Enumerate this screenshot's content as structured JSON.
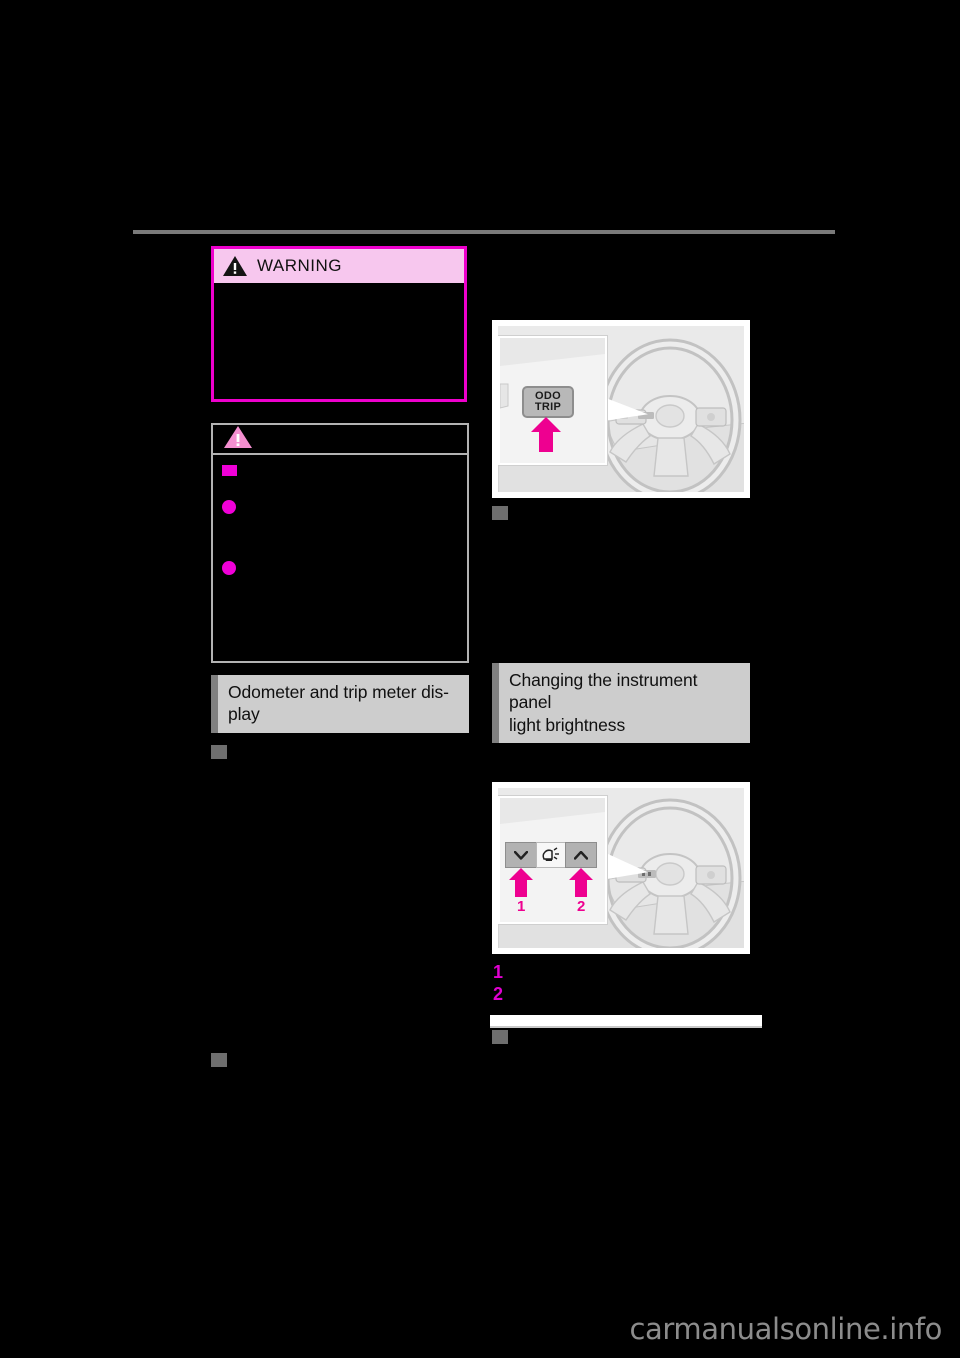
{
  "document": {
    "watermark": "carmanualsonline.info"
  },
  "left_column": {
    "warning_box": {
      "icon": "warning-triangle-icon",
      "title": "WARNING",
      "body_text": ""
    },
    "notice_box": {
      "icon": "notice-triangle-icon",
      "bullets": [
        {
          "marker": "square",
          "text": ""
        },
        {
          "marker": "circle",
          "text": ""
        },
        {
          "marker": "circle",
          "text": ""
        }
      ]
    },
    "section_heading": "Odometer and trip meter dis-\nplay",
    "subsections": [
      {
        "marker": "gray-square",
        "text": ""
      },
      {
        "marker": "gray-square",
        "text": ""
      }
    ]
  },
  "right_column": {
    "illustration_odo": {
      "name": "steering-wheel-odo-trip-illustration",
      "button_label_line1": "ODO",
      "button_label_line2": "TRIP",
      "arrow": "magenta-up-arrow"
    },
    "subsection_after_illustration": {
      "marker": "gray-square",
      "text": ""
    },
    "section_heading": "Changing the instrument panel\nlight brightness",
    "illustration_brightness": {
      "name": "instrument-panel-brightness-illustration",
      "buttons": [
        {
          "number": "1",
          "icon": "chevron-down-icon"
        },
        {
          "icon": "brightness-lamp-icon"
        },
        {
          "number": "2",
          "icon": "chevron-up-icon"
        }
      ]
    },
    "steps": [
      {
        "number": "1",
        "text": ""
      },
      {
        "number": "2",
        "text": ""
      }
    ],
    "cut_off_row": {
      "marker": "gray-square",
      "text": ""
    }
  }
}
